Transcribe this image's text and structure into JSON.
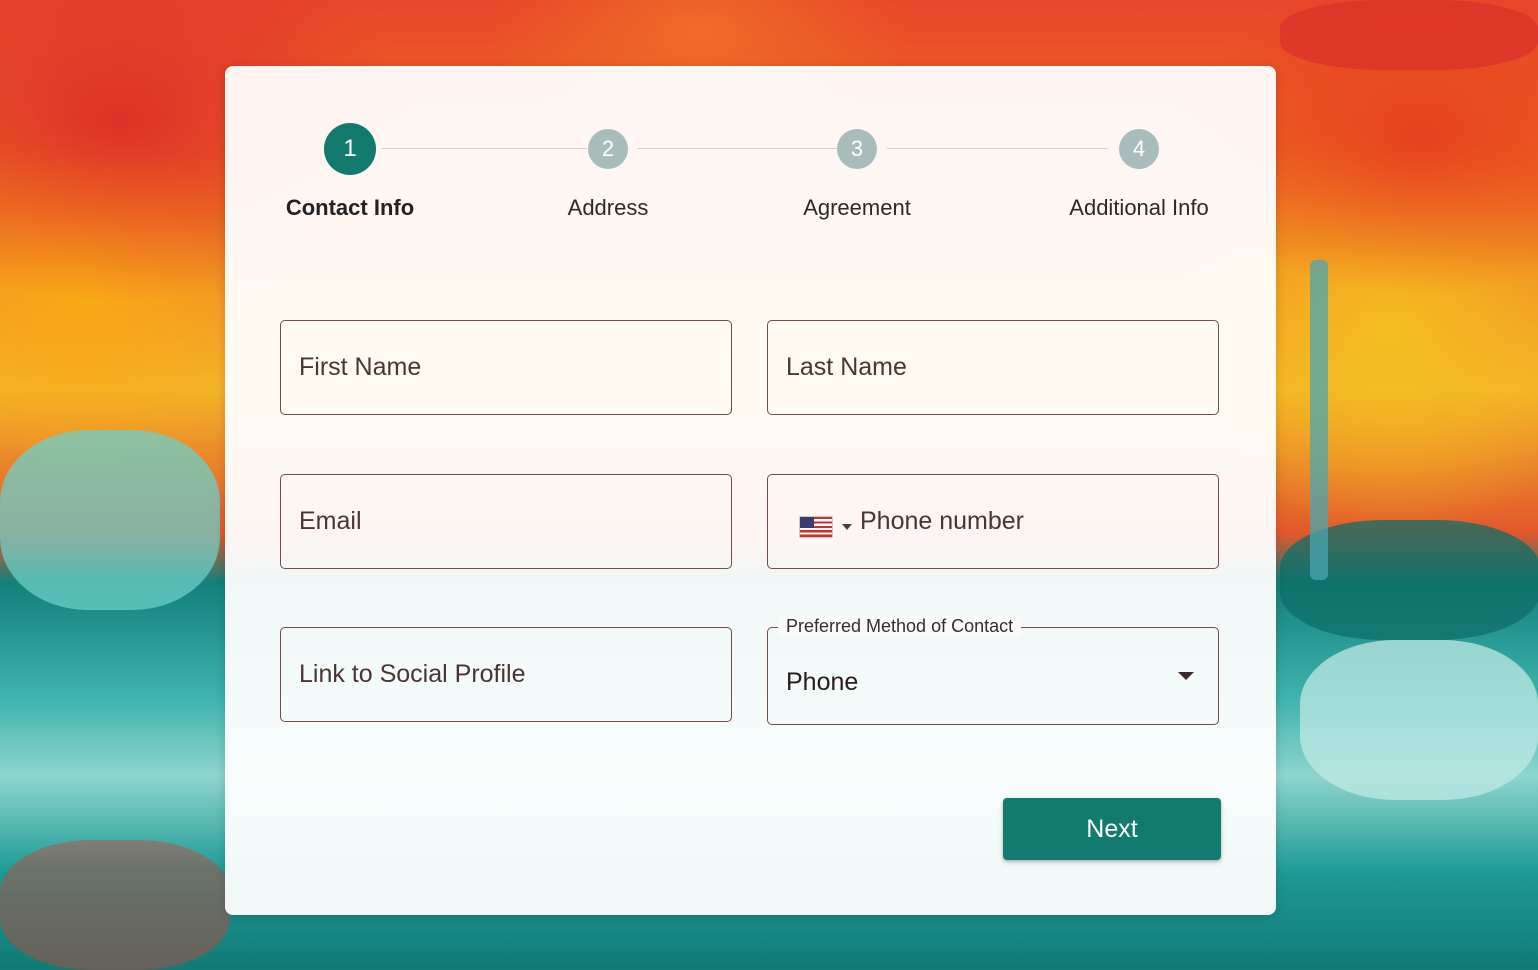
{
  "stepper": {
    "steps": [
      {
        "number": "1",
        "label": "Contact Info",
        "state": "active"
      },
      {
        "number": "2",
        "label": "Address",
        "state": "inactive"
      },
      {
        "number": "3",
        "label": "Agreement",
        "state": "inactive"
      },
      {
        "number": "4",
        "label": "Additional Info",
        "state": "inactive"
      }
    ],
    "active_color": "#137a70",
    "inactive_color": "#a9bcbc"
  },
  "form": {
    "first_name": {
      "placeholder": "First Name",
      "value": ""
    },
    "last_name": {
      "placeholder": "Last Name",
      "value": ""
    },
    "email": {
      "placeholder": "Email",
      "value": ""
    },
    "phone": {
      "placeholder": "Phone number",
      "value": "",
      "country_flag_icon": "us-flag-icon"
    },
    "social_profile": {
      "placeholder": "Link to Social Profile",
      "value": ""
    },
    "preferred_contact": {
      "label": "Preferred Method of Contact",
      "selected": "Phone"
    }
  },
  "actions": {
    "next_label": "Next",
    "button_color": "#137a70"
  }
}
